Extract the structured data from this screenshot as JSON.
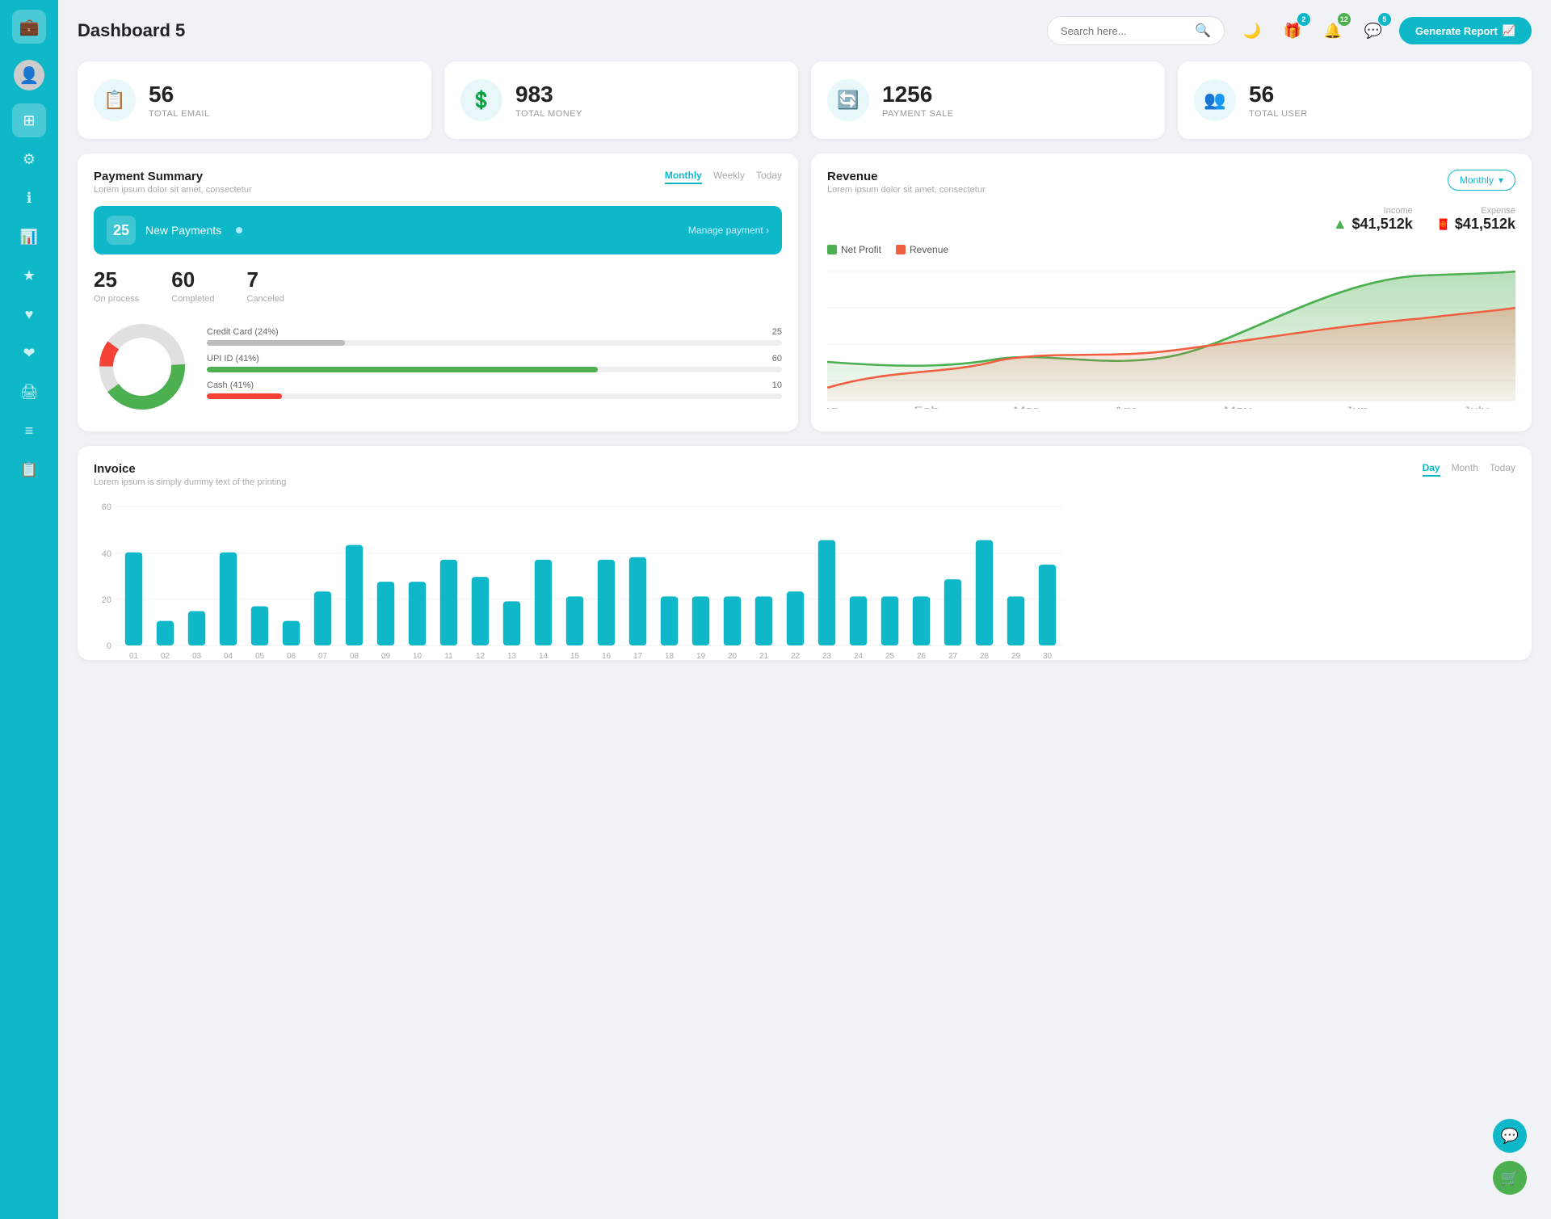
{
  "sidebar": {
    "logo_icon": "💼",
    "items": [
      {
        "id": "avatar",
        "icon": "👤",
        "active": false
      },
      {
        "id": "dashboard",
        "icon": "⊞",
        "active": true
      },
      {
        "id": "settings",
        "icon": "⚙",
        "active": false
      },
      {
        "id": "info",
        "icon": "ℹ",
        "active": false
      },
      {
        "id": "analytics",
        "icon": "📊",
        "active": false
      },
      {
        "id": "star",
        "icon": "★",
        "active": false
      },
      {
        "id": "heart",
        "icon": "♥",
        "active": false
      },
      {
        "id": "heart2",
        "icon": "❤",
        "active": false
      },
      {
        "id": "print",
        "icon": "🖨",
        "active": false
      },
      {
        "id": "list",
        "icon": "≡",
        "active": false
      },
      {
        "id": "doc",
        "icon": "📋",
        "active": false
      }
    ]
  },
  "header": {
    "title": "Dashboard 5",
    "search_placeholder": "Search here...",
    "badge_gift": "2",
    "badge_bell": "12",
    "badge_chat": "5",
    "btn_generate": "Generate Report"
  },
  "stats": [
    {
      "id": "total-email",
      "number": "56",
      "label": "TOTAL EMAIL",
      "icon": "📋"
    },
    {
      "id": "total-money",
      "number": "983",
      "label": "TOTAL MONEY",
      "icon": "💲"
    },
    {
      "id": "payment-sale",
      "number": "1256",
      "label": "PAYMENT SALE",
      "icon": "🔄"
    },
    {
      "id": "total-user",
      "number": "56",
      "label": "TOTAL USER",
      "icon": "👥"
    }
  ],
  "payment_summary": {
    "title": "Payment Summary",
    "subtitle": "Lorem ipsum dolor sit amet, consectetur",
    "tabs": [
      "Monthly",
      "Weekly",
      "Today"
    ],
    "active_tab": "Monthly",
    "new_payments_count": "25",
    "new_payments_label": "New Payments",
    "manage_link": "Manage payment",
    "metrics": [
      {
        "value": "25",
        "label": "On process"
      },
      {
        "value": "60",
        "label": "Completed"
      },
      {
        "value": "7",
        "label": "Canceled"
      }
    ],
    "progress_items": [
      {
        "label": "Credit Card (24%)",
        "value": 24,
        "count": "25",
        "color": "#999"
      },
      {
        "label": "UPI ID (41%)",
        "value": 41,
        "count": "60",
        "color": "#4caf50"
      },
      {
        "label": "Cash (41%)",
        "value": 10,
        "count": "10",
        "color": "#f44336"
      }
    ]
  },
  "revenue": {
    "title": "Revenue",
    "subtitle": "Lorem ipsum dolor sit amet, consectetur",
    "active_tab": "Monthly",
    "income_label": "Income",
    "income_amount": "$41,512k",
    "expense_label": "Expense",
    "expense_amount": "$41,512k",
    "legend": [
      {
        "label": "Net Profit",
        "color": "#4caf50"
      },
      {
        "label": "Revenue",
        "color": "#f06040"
      }
    ],
    "chart": {
      "labels": [
        "Jan",
        "Feb",
        "Mar",
        "Apr",
        "May",
        "Jun",
        "July"
      ],
      "net_profit": [
        28,
        25,
        30,
        20,
        35,
        90,
        95
      ],
      "revenue": [
        10,
        30,
        25,
        35,
        30,
        45,
        55
      ]
    }
  },
  "invoice": {
    "title": "Invoice",
    "subtitle": "Lorem ipsum is simply dummy text of the printing",
    "tabs": [
      "Day",
      "Month",
      "Today"
    ],
    "active_tab": "Day",
    "y_labels": [
      "60",
      "40",
      "20",
      "0"
    ],
    "x_labels": [
      "01",
      "02",
      "03",
      "04",
      "05",
      "06",
      "07",
      "08",
      "09",
      "10",
      "11",
      "12",
      "13",
      "14",
      "15",
      "16",
      "17",
      "18",
      "19",
      "20",
      "21",
      "22",
      "23",
      "24",
      "25",
      "26",
      "27",
      "28",
      "29",
      "30"
    ],
    "bars": [
      38,
      10,
      14,
      38,
      16,
      10,
      22,
      41,
      26,
      26,
      35,
      28,
      18,
      35,
      20,
      35,
      36,
      20,
      20,
      20,
      20,
      22,
      43,
      20,
      20,
      20,
      27,
      43,
      20,
      33
    ]
  },
  "float_btns": [
    {
      "id": "support",
      "icon": "💬",
      "color": "teal"
    },
    {
      "id": "cart",
      "icon": "🛒",
      "color": "green"
    }
  ]
}
